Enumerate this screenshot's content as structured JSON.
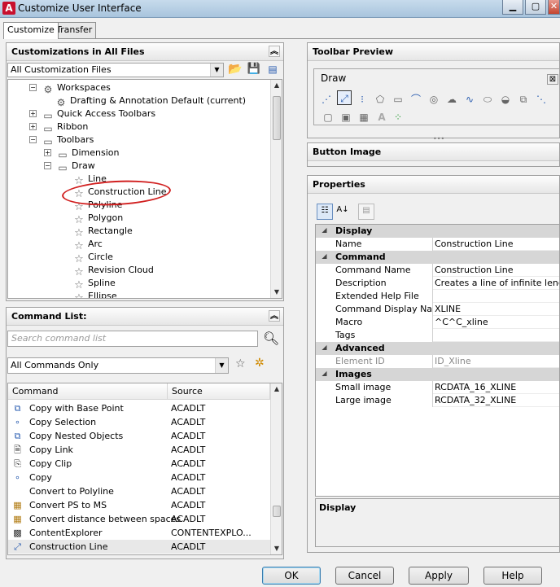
{
  "window": {
    "title": "Customize User Interface",
    "app_icon": "A"
  },
  "tabs": [
    {
      "label": "Customize"
    },
    {
      "label": "Transfer"
    }
  ],
  "customizations": {
    "header": "Customizations in All Files",
    "file_combo": "All Customization Files",
    "tree": [
      {
        "label": "Workspaces",
        "icon": "gear-icon"
      },
      {
        "label": "Drafting & Annotation Default (current)",
        "icon": "gear-icon"
      },
      {
        "label": "Quick Access Toolbars",
        "icon": "toolbar-icon"
      },
      {
        "label": "Ribbon",
        "icon": "ribbon-icon"
      },
      {
        "label": "Toolbars",
        "icon": "toolbar-icon"
      },
      {
        "label": "Dimension",
        "icon": "toolbar-icon"
      },
      {
        "label": "Draw",
        "icon": "toolbar-icon"
      },
      {
        "label": "Line",
        "icon": "star-icon"
      },
      {
        "label": "Construction Line",
        "icon": "star-icon"
      },
      {
        "label": "Polyline",
        "icon": "star-icon"
      },
      {
        "label": "Polygon",
        "icon": "star-icon"
      },
      {
        "label": "Rectangle",
        "icon": "star-icon"
      },
      {
        "label": "Arc",
        "icon": "star-icon"
      },
      {
        "label": "Circle",
        "icon": "star-icon"
      },
      {
        "label": "Revision Cloud",
        "icon": "star-icon"
      },
      {
        "label": "Spline",
        "icon": "star-icon"
      },
      {
        "label": "Ellipse",
        "icon": "star-icon"
      }
    ]
  },
  "command_list": {
    "header": "Command List:",
    "search_placeholder": "Search command list",
    "filter_combo": "All Commands Only",
    "columns": {
      "command": "Command",
      "source": "Source"
    },
    "rows": [
      {
        "command": "Copy with Base Point",
        "source": "ACADLT"
      },
      {
        "command": "Copy Selection",
        "source": "ACADLT"
      },
      {
        "command": "Copy Nested Objects",
        "source": "ACADLT"
      },
      {
        "command": "Copy Link",
        "source": "ACADLT"
      },
      {
        "command": "Copy Clip",
        "source": "ACADLT"
      },
      {
        "command": "Copy",
        "source": "ACADLT"
      },
      {
        "command": "Convert to Polyline",
        "source": "ACADLT"
      },
      {
        "command": "Convert PS to MS",
        "source": "ACADLT"
      },
      {
        "command": "Convert distance between spaces",
        "source": "ACADLT"
      },
      {
        "command": "ContentExplorer",
        "source": "CONTENTEXPLO..."
      },
      {
        "command": "Construction Line",
        "source": "ACADLT"
      }
    ]
  },
  "toolbar_preview": {
    "header": "Toolbar Preview",
    "toolbar_name": "Draw",
    "close_glyph": "⊠"
  },
  "button_image": {
    "header": "Button Image"
  },
  "properties": {
    "header": "Properties",
    "categories": [
      {
        "name": "Display",
        "rows": [
          {
            "name": "Name",
            "value": "Construction Line"
          }
        ]
      },
      {
        "name": "Command",
        "rows": [
          {
            "name": "Command Name",
            "value": "Construction Line"
          },
          {
            "name": "Description",
            "value": "Creates a line of infinite length"
          },
          {
            "name": "Extended Help File",
            "value": ""
          },
          {
            "name": "Command Display Name",
            "value": "XLINE"
          },
          {
            "name": "Macro",
            "value": "^C^C_xline"
          },
          {
            "name": "Tags",
            "value": ""
          }
        ]
      },
      {
        "name": "Advanced",
        "rows": [
          {
            "name": "Element ID",
            "value": "ID_Xline"
          }
        ]
      },
      {
        "name": "Images",
        "rows": [
          {
            "name": "Small image",
            "value": "RCDATA_16_XLINE"
          },
          {
            "name": "Large image",
            "value": "RCDATA_32_XLINE"
          }
        ]
      }
    ],
    "description_title": "Display"
  },
  "buttons": {
    "ok": "OK",
    "cancel": "Cancel",
    "apply": "Apply",
    "help": "Help"
  },
  "accent_colors": {
    "annotation_circle": "#d12020",
    "title_bar": "#a8c4dd"
  }
}
